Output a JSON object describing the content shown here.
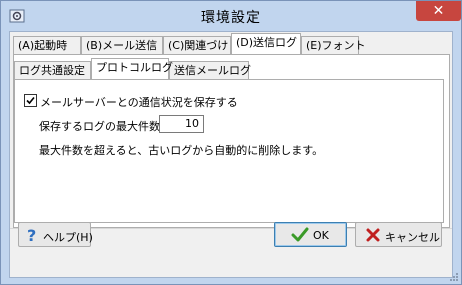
{
  "window": {
    "title": "環境設定",
    "app_icon": "settings-app-icon",
    "close_glyph": "✕"
  },
  "tabs_top": [
    {
      "label": "(A)起動時"
    },
    {
      "label": "(B)メール送信"
    },
    {
      "label": "(C)関連づけ"
    },
    {
      "label": "(D)送信ログ",
      "active": true
    },
    {
      "label": "(E)フォント"
    }
  ],
  "tabs_sub": [
    {
      "label": "ログ共通設定"
    },
    {
      "label": "プロトコルログ",
      "active": true
    },
    {
      "label": "送信メールログ"
    }
  ],
  "protocol_log": {
    "save_checkbox_label": "メールサーバーとの通信状況を保存する",
    "save_checked": true,
    "max_count_label": "保存するログの最大件数",
    "max_count_value": "10",
    "note": "最大件数を超えると、古いログから自動的に削除します。"
  },
  "buttons": {
    "help": "ヘルプ(H)",
    "ok": "OK",
    "cancel": "キャンセル"
  },
  "colors": {
    "window_frame": "#c1d5ee",
    "close_button": "#c7463f",
    "ok_icon": "#3a9a28",
    "cancel_icon": "#c02020",
    "help_icon": "#2f6fc0"
  }
}
